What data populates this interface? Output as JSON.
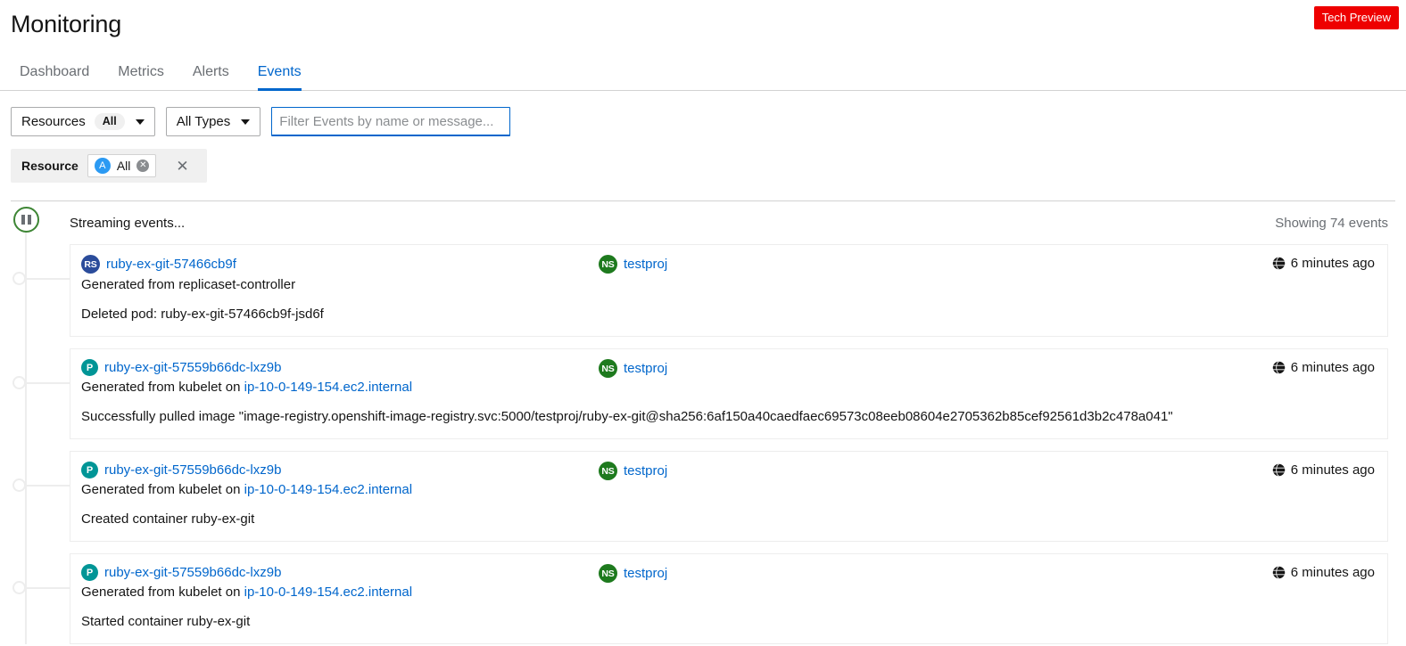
{
  "header": {
    "title": "Monitoring",
    "badge": "Tech Preview",
    "badge_color": "#ee0000"
  },
  "tabs": [
    {
      "label": "Dashboard",
      "active": false
    },
    {
      "label": "Metrics",
      "active": false
    },
    {
      "label": "Alerts",
      "active": false
    },
    {
      "label": "Events",
      "active": true
    }
  ],
  "toolbar": {
    "resources_dropdown": {
      "label": "Resources",
      "count": "All",
      "icon": "chevron-down-icon"
    },
    "types_dropdown": {
      "label": "All Types",
      "icon": "chevron-down-icon"
    },
    "filter_input": {
      "value": "",
      "placeholder": "Filter Events by name or message..."
    },
    "chip_group_label": "Resource",
    "chip": {
      "avatar": "A",
      "label": "All",
      "close_icon": "close-icon"
    },
    "clear_all_icon": "close-icon"
  },
  "stream": {
    "status": "Streaming events...",
    "showing": "Showing 74 events",
    "pause_icon": "pause-icon"
  },
  "events": [
    {
      "kind_abbr": "RS",
      "kind_class": "badge-rs",
      "name": "ruby-ex-git-57466cb9f",
      "source": "Generated from replicaset-controller",
      "source_link": "",
      "namespace_abbr": "NS",
      "namespace": "testproj",
      "time": "6 minutes ago",
      "message": "Deleted pod: ruby-ex-git-57466cb9f-jsd6f"
    },
    {
      "kind_abbr": "P",
      "kind_class": "badge-p",
      "name": "ruby-ex-git-57559b66dc-lxz9b",
      "source": "Generated from kubelet on ",
      "source_link": "ip-10-0-149-154.ec2.internal",
      "namespace_abbr": "NS",
      "namespace": "testproj",
      "time": "6 minutes ago",
      "message": "Successfully pulled image \"image-registry.openshift-image-registry.svc:5000/testproj/ruby-ex-git@sha256:6af150a40caedfaec69573c08eeb08604e2705362b85cef92561d3b2c478a041\""
    },
    {
      "kind_abbr": "P",
      "kind_class": "badge-p",
      "name": "ruby-ex-git-57559b66dc-lxz9b",
      "source": "Generated from kubelet on ",
      "source_link": "ip-10-0-149-154.ec2.internal",
      "namespace_abbr": "NS",
      "namespace": "testproj",
      "time": "6 minutes ago",
      "message": "Created container ruby-ex-git"
    },
    {
      "kind_abbr": "P",
      "kind_class": "badge-p",
      "name": "ruby-ex-git-57559b66dc-lxz9b",
      "source": "Generated from kubelet on ",
      "source_link": "ip-10-0-149-154.ec2.internal",
      "namespace_abbr": "NS",
      "namespace": "testproj",
      "time": "6 minutes ago",
      "message": "Started container ruby-ex-git"
    }
  ],
  "colors": {
    "accent": "#06c",
    "replicaset_badge": "#2b4c9b",
    "pod_badge": "#009596",
    "namespace_badge": "#1e7a1e",
    "streaming_active": "#3e8635"
  }
}
